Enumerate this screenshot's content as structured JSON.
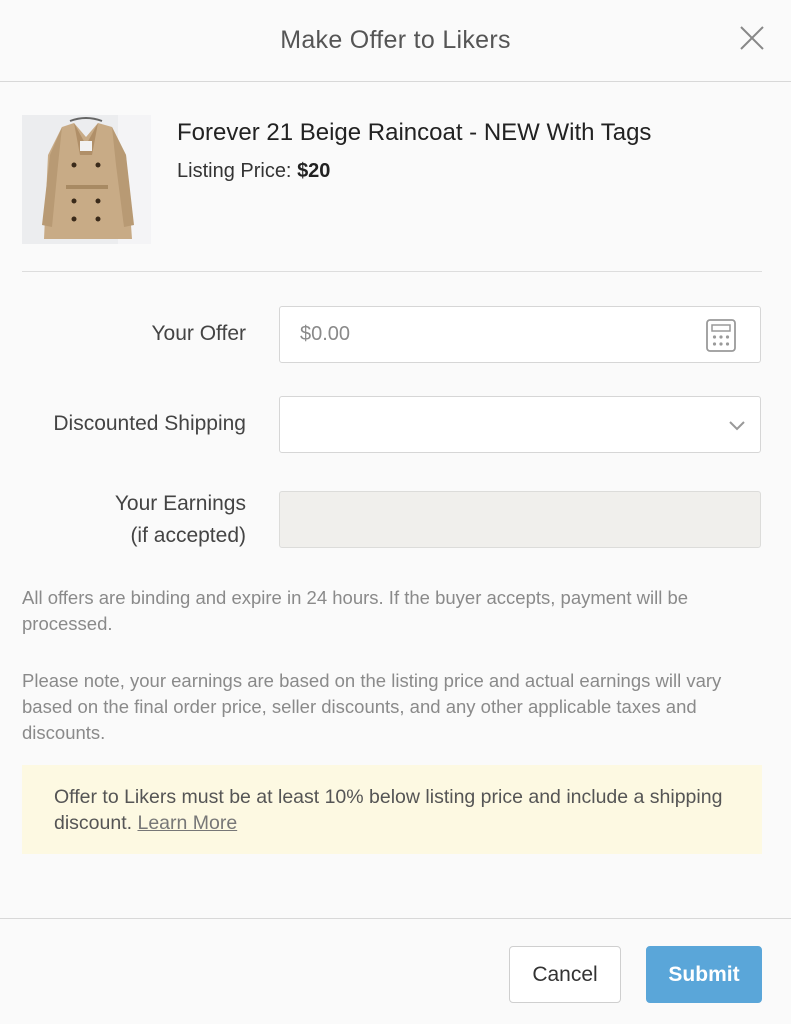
{
  "header": {
    "title": "Make Offer to Likers"
  },
  "listing": {
    "title": "Forever 21 Beige Raincoat - NEW With Tags",
    "price_label": "Listing Price: ",
    "price_value": "$20",
    "image_description": "photo of a beige trench coat on a hanger"
  },
  "form": {
    "offer_label": "Your Offer",
    "offer_placeholder": "$0.00",
    "offer_value": "",
    "shipping_label": "Discounted Shipping",
    "shipping_selected": "",
    "earnings_label_line1": "Your Earnings",
    "earnings_label_line2": "(if accepted)",
    "earnings_value": ""
  },
  "notes": {
    "binding": "All offers are binding and expire in 24 hours. If the buyer accepts, payment will be processed.",
    "earnings": "Please note, your earnings are based on the listing price and actual earnings will vary based on the final order price, seller discounts, and any other applicable taxes and discounts."
  },
  "banner": {
    "text": "Offer to Likers must be at least 10% below listing price and include a shipping discount. ",
    "link": "Learn More"
  },
  "footer": {
    "cancel_label": "Cancel",
    "submit_label": "Submit"
  },
  "colors": {
    "accent": "#5aa6d9",
    "banner_bg": "#fdf9e2",
    "disabled_field": "#f0efec"
  },
  "icons": {
    "close": "close-icon",
    "calculator": "calculator-icon",
    "dropdown": "chevron-down-icon"
  }
}
